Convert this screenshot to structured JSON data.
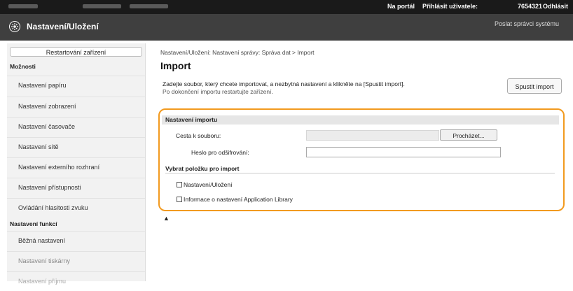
{
  "topbar": {
    "portal": "Na portál",
    "login_label": "Přihlásit uživatele:",
    "user": "7654321",
    "logout": "Odhlásit"
  },
  "header": {
    "title": "Nastavení/Uložení",
    "send_admin": "Poslat správci systému"
  },
  "sidebar": {
    "restart": "Restartování zařízení",
    "section1": "Možnosti",
    "items1": [
      "Nastavení papíru",
      "Nastavení zobrazení",
      "Nastavení časovače",
      "Nastavení sítě",
      "Nastavení externího rozhraní",
      "Nastavení přístupnosti",
      "Ovládání hlasitosti zvuku"
    ],
    "section2": "Nastavení funkcí",
    "items2": [
      "Běžná nastavení",
      "Nastavení tiskárny",
      "Nastavení příjmu"
    ]
  },
  "main": {
    "breadcrumb": "Nastavení/Uložení: Nastavení správy: Správa dat > Import",
    "title": "Import",
    "description": "Zadejte soubor, který chcete importovat, a nezbytná nastavení a klikněte na [Spustit import].",
    "note": "Po dokončení importu restartujte zařízení.",
    "run_button": "Spustit import",
    "panel": {
      "section_title": "Nastavení importu",
      "path_label": "Cesta k souboru:",
      "path_value": "",
      "browse_button": "Procházet...",
      "password_label": "Heslo pro odšifrování:",
      "password_value": "",
      "select_title": "Vybrat položku pro import",
      "checkboxes": [
        {
          "label": "Nastavení/Uložení",
          "checked": false
        },
        {
          "label": "Informace o nastavení Application Library",
          "checked": false
        }
      ]
    },
    "to_top": "▲"
  },
  "colors": {
    "topbar": "#1a1a1a",
    "header": "#3f3f3f",
    "highlight": "#f29a1f"
  }
}
